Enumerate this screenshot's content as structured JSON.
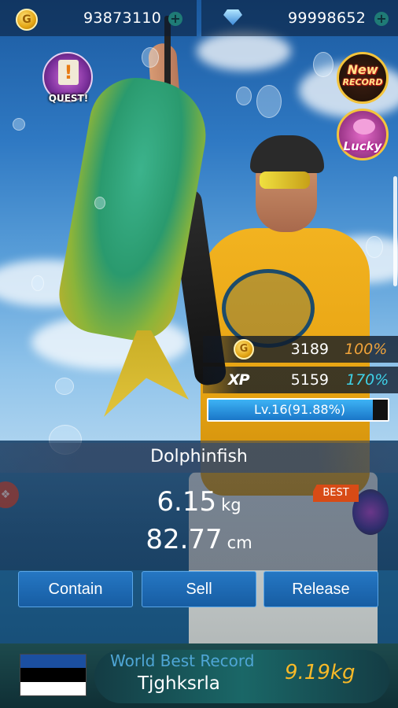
{
  "currency": {
    "coins": "93873110",
    "gems": "99998652"
  },
  "side_buttons": {
    "quest_label": "QUEST!",
    "quest_mark": "!",
    "record_line1": "New",
    "record_line2": "RECORD",
    "lucky_label": "Lucky"
  },
  "rewards": {
    "coins_value": "3189",
    "coins_bonus": "100%",
    "xp_label": "XP",
    "xp_value": "5159",
    "xp_bonus": "170%",
    "level_text": "Lv.16(91.88%)",
    "level_progress": 0.9188
  },
  "catch": {
    "fish_name": "Dolphinfish",
    "weight": "6.15",
    "weight_unit": "kg",
    "length": "82.77",
    "length_unit": "cm",
    "best_tag": "BEST"
  },
  "actions": {
    "contain": "Contain",
    "sell": "Sell",
    "release": "Release"
  },
  "world_record": {
    "title": "World Best Record",
    "holder": "Tjghksrla",
    "value": "9.19kg",
    "flag_colors": [
      "#1b4fa0",
      "#000000",
      "#ffffff"
    ]
  },
  "colors": {
    "accent_orange": "#f0a33a",
    "accent_cyan": "#3ed2e8",
    "button_blue": "#1f6db8",
    "record_gold": "#f7b928"
  },
  "icons": [
    "coin-icon",
    "gem-icon",
    "plus-icon",
    "quest-icon",
    "new-record-icon",
    "lucky-icon",
    "xp-icon",
    "menu-tab-icon"
  ]
}
